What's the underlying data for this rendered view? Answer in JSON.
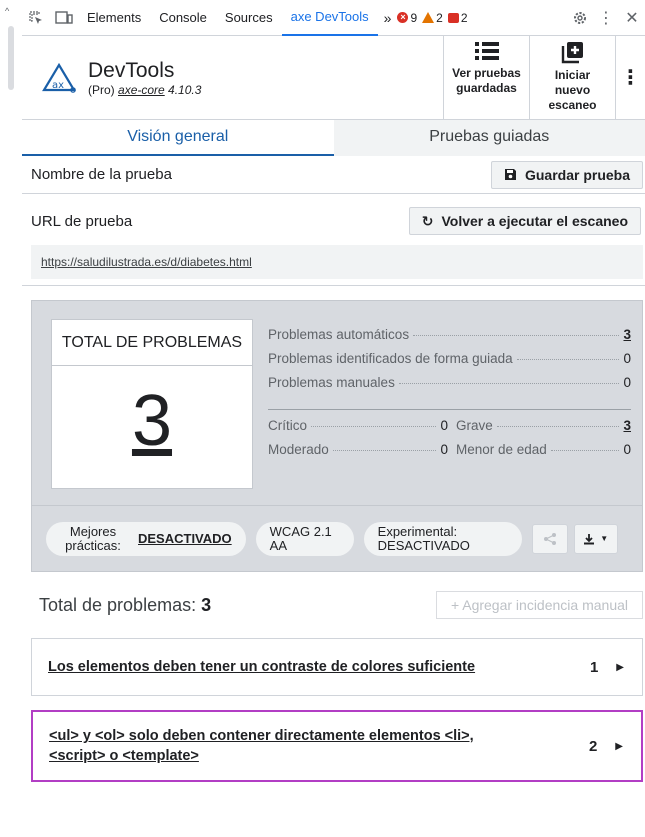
{
  "devtools": {
    "tabs": [
      "Elements",
      "Console",
      "Sources",
      "axe DevTools"
    ],
    "active_tab": "axe DevTools",
    "more": "»",
    "error_count": "9",
    "warning_count": "2",
    "issue_count": "2"
  },
  "header": {
    "title": "DevTools",
    "edition": "(Pro)",
    "core_link": "axe-core",
    "core_version": " 4.10.3",
    "saved_tests_label": "Ver pruebas guardadas",
    "new_scan_label": "Iniciar nuevo escaneo"
  },
  "view_tabs": {
    "overview": "Visión general",
    "guided": "Pruebas guiadas"
  },
  "test_name": {
    "label": "Nombre de la prueba",
    "save_button": "Guardar prueba"
  },
  "test_url": {
    "label": "URL de prueba",
    "rerun_button": "Volver a ejecutar el escaneo",
    "url": "https://saludilustrada.es/d/diabetes.html"
  },
  "summary": {
    "total_title": "TOTAL DE PROBLEMAS",
    "total_value": "3",
    "automatic_label": "Problemas automáticos",
    "automatic_value": "3",
    "guided_label": "Problemas identificados de forma guiada",
    "guided_value": "0",
    "manual_label": "Problemas manuales",
    "manual_value": "0",
    "critical_label": "Crítico",
    "critical_value": "0",
    "serious_label": "Grave",
    "serious_value": "3",
    "moderate_label": "Moderado",
    "moderate_value": "0",
    "minor_label": "Menor de edad",
    "minor_value": "0",
    "best_practices_label": "Mejores prácticas:",
    "best_practices_value": "DESACTIVADO",
    "wcag_label": "WCAG 2.1 AA",
    "experimental_label": "Experimental: DESACTIVADO"
  },
  "issues": {
    "heading": "Total de problemas:",
    "heading_count": "3",
    "add_manual": "+ Agregar incidencia manual",
    "list": [
      {
        "text": "Los elementos deben tener un contraste de colores suficiente",
        "count": "1"
      },
      {
        "text": "<ul> y <ol> solo deben contener directamente elementos <li>, <script> o <template>",
        "count": "2"
      }
    ]
  },
  "colors": {
    "accent": "#1a73e8",
    "selected_border": "#b23ec4",
    "summary_bg": "#d7dadf"
  }
}
